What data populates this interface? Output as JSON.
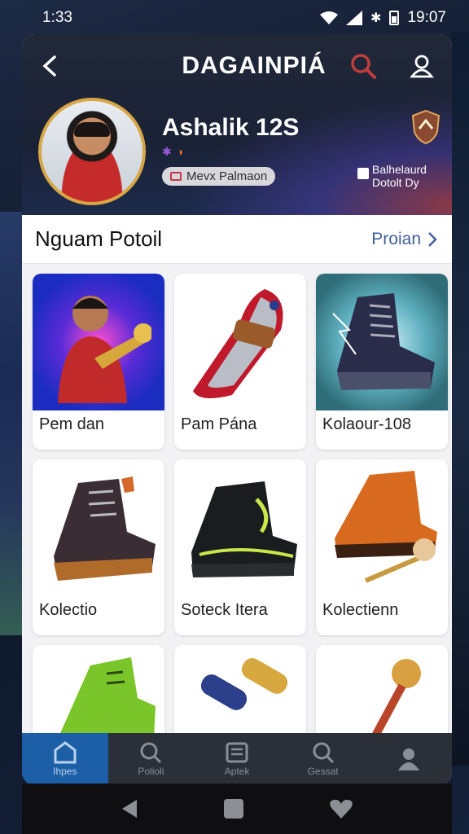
{
  "status_bar": {
    "time": "1:33",
    "clock": "19:07"
  },
  "header": {
    "title": "DAGAINPIÁ",
    "username": "Ashalik 12S",
    "tag": "Mevx Palmaon",
    "side_badge": "Balhelaurd Dotolt Dy"
  },
  "section": {
    "title": "Nguam Potoil",
    "see_all": "Proian"
  },
  "items": [
    {
      "label": "Pem dan",
      "icon": "trumpet-player-image"
    },
    {
      "label": "Pam Pána",
      "icon": "red-shoe-image"
    },
    {
      "label": "Kolaour-108",
      "icon": "lightning-boot-image"
    },
    {
      "label": "Kolectio",
      "icon": "dark-boot-image"
    },
    {
      "label": "Soteck Itera",
      "icon": "black-boot-image"
    },
    {
      "label": "Kolectienn",
      "icon": "orange-boot-image"
    }
  ],
  "bottom_nav": [
    {
      "label": "Ihpes",
      "icon": "home-icon",
      "active": true
    },
    {
      "label": "Polioli",
      "icon": "search-icon"
    },
    {
      "label": "Aptek",
      "icon": "list-icon"
    },
    {
      "label": "Gessat",
      "icon": "search-icon"
    },
    {
      "label": "",
      "icon": "user-icon"
    }
  ],
  "colors": {
    "accent": "#1d5fa6",
    "link": "#3f5f9a",
    "avatar_ring": "#d9a645"
  }
}
